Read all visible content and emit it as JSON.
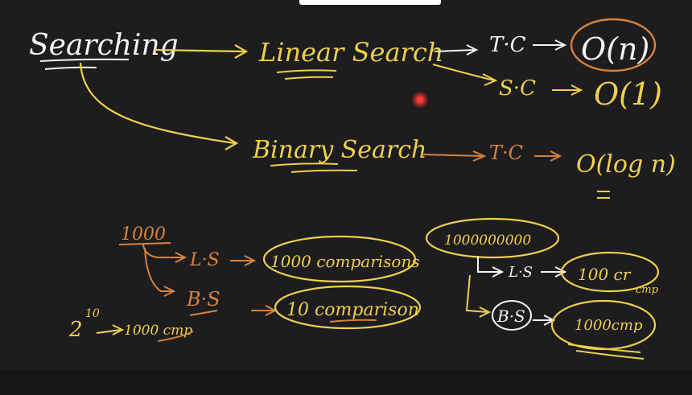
{
  "notes": {
    "searching": "Searching",
    "linear_search": "Linear Search",
    "binary_search": "Binary Search",
    "tc_label": "T·C",
    "sc_label": "S·C",
    "linear_tc": "O(n)",
    "linear_sc": "O(1)",
    "binary_tc": "O(log n)",
    "n_small": "1000",
    "ls_short": "L·S",
    "bs_short": "B·S",
    "ls_small_result": "1000 comparisons",
    "bs_small_result": "10 comparison",
    "power_base": "2",
    "power_exp": "10",
    "power_result": "1000 cmp",
    "n_large": "1000000000",
    "ls_large_result": "100 cr",
    "ls_large_result_sub": "cmp",
    "bs_large_result": "1000cmp"
  },
  "colors": {
    "board": "#1d1d1f",
    "white_ink": "#f4f4f4",
    "yellow_ink": "#f0cf4c",
    "orange_ink": "#d9823b",
    "laser": "#e8312f"
  }
}
